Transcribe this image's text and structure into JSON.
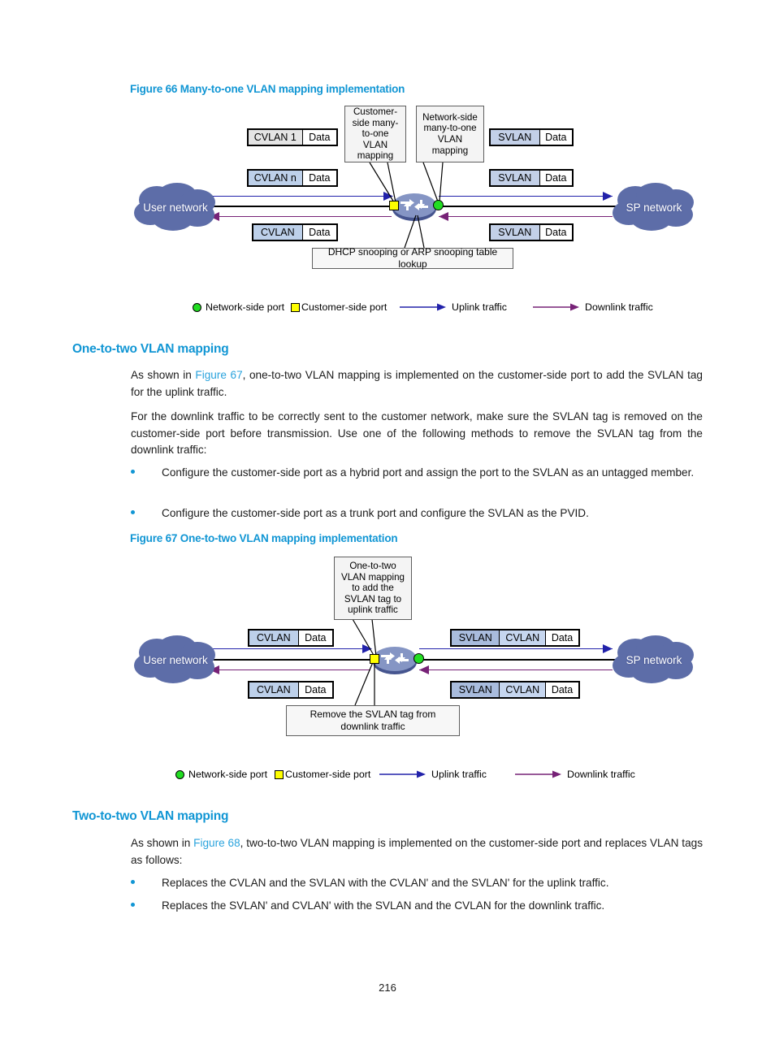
{
  "page": {
    "number": "216"
  },
  "figure66": {
    "caption": "Figure 66 Many-to-one VLAN mapping implementation",
    "clouds": {
      "left": "User network",
      "right": "SP network"
    },
    "callouts": {
      "customer_side": "Customer-side many-to-one VLAN mapping",
      "network_side": "Network-side many-to-one VLAN mapping",
      "lookup": "DHCP snooping or ARP snooping table lookup"
    },
    "packets": {
      "left_top": [
        "CVLAN 1",
        "Data"
      ],
      "left_mid": [
        "CVLAN n",
        "Data"
      ],
      "left_bottom": [
        "CVLAN",
        "Data"
      ],
      "right_top": [
        "SVLAN",
        "Data"
      ],
      "right_mid": [
        "SVLAN",
        "Data"
      ],
      "right_bottom": [
        "SVLAN",
        "Data"
      ]
    },
    "legend": {
      "network_side_port": "Network-side port",
      "customer_side_port": "Customer-side port",
      "uplink": "Uplink traffic",
      "downlink": "Downlink traffic"
    }
  },
  "section_one_to_two": {
    "heading": "One-to-two VLAN mapping",
    "para1_before": "As shown in ",
    "para1_xref": "Figure 67",
    "para1_after": ", one-to-two VLAN mapping is implemented on the customer-side port to add the SVLAN tag for the uplink traffic.",
    "para2": "For the downlink traffic to be correctly sent to the customer network, make sure the SVLAN tag is removed on the customer-side port before transmission. Use one of the following methods to remove the SVLAN tag from the downlink traffic:",
    "bullets": [
      "Configure the customer-side port as a hybrid port and assign the port to the SVLAN as an untagged member.",
      "Configure the customer-side port as a trunk port and configure the SVLAN as the PVID."
    ]
  },
  "figure67": {
    "caption": "Figure 67 One-to-two VLAN mapping implementation",
    "clouds": {
      "left": "User network",
      "right": "SP network"
    },
    "callouts": {
      "top": "One-to-two VLAN mapping to add the SVLAN tag to uplink traffic",
      "bottom": "Remove the SVLAN tag from downlink traffic"
    },
    "packets": {
      "left_top": [
        "CVLAN",
        "Data"
      ],
      "left_bottom": [
        "CVLAN",
        "Data"
      ],
      "right_top": [
        "SVLAN",
        "CVLAN",
        "Data"
      ],
      "right_bottom": [
        "SVLAN",
        "CVLAN",
        "Data"
      ]
    },
    "legend": {
      "network_side_port": "Network-side port",
      "customer_side_port": "Customer-side port",
      "uplink": "Uplink traffic",
      "downlink": "Downlink traffic"
    }
  },
  "section_two_to_two": {
    "heading": "Two-to-two VLAN mapping",
    "para1_before": "As shown in ",
    "para1_xref": "Figure 68",
    "para1_after": ", two-to-two VLAN mapping is implemented on the customer-side port and replaces VLAN tags as follows:",
    "bullets": [
      "Replaces the CVLAN and the SVLAN with the CVLAN' and the SVLAN' for the uplink traffic.",
      "Replaces the SVLAN' and CVLAN' with the SVLAN and the CVLAN for the downlink traffic."
    ]
  },
  "colors": {
    "heading_blue": "#1196d4",
    "xref_blue": "#2aa3dd",
    "cloud_blue": "#5d6da8",
    "uplink_blue": "#2222aa",
    "downlink_purple": "#772277",
    "port_green": "#22dd22",
    "port_yellow": "#ffff00"
  }
}
